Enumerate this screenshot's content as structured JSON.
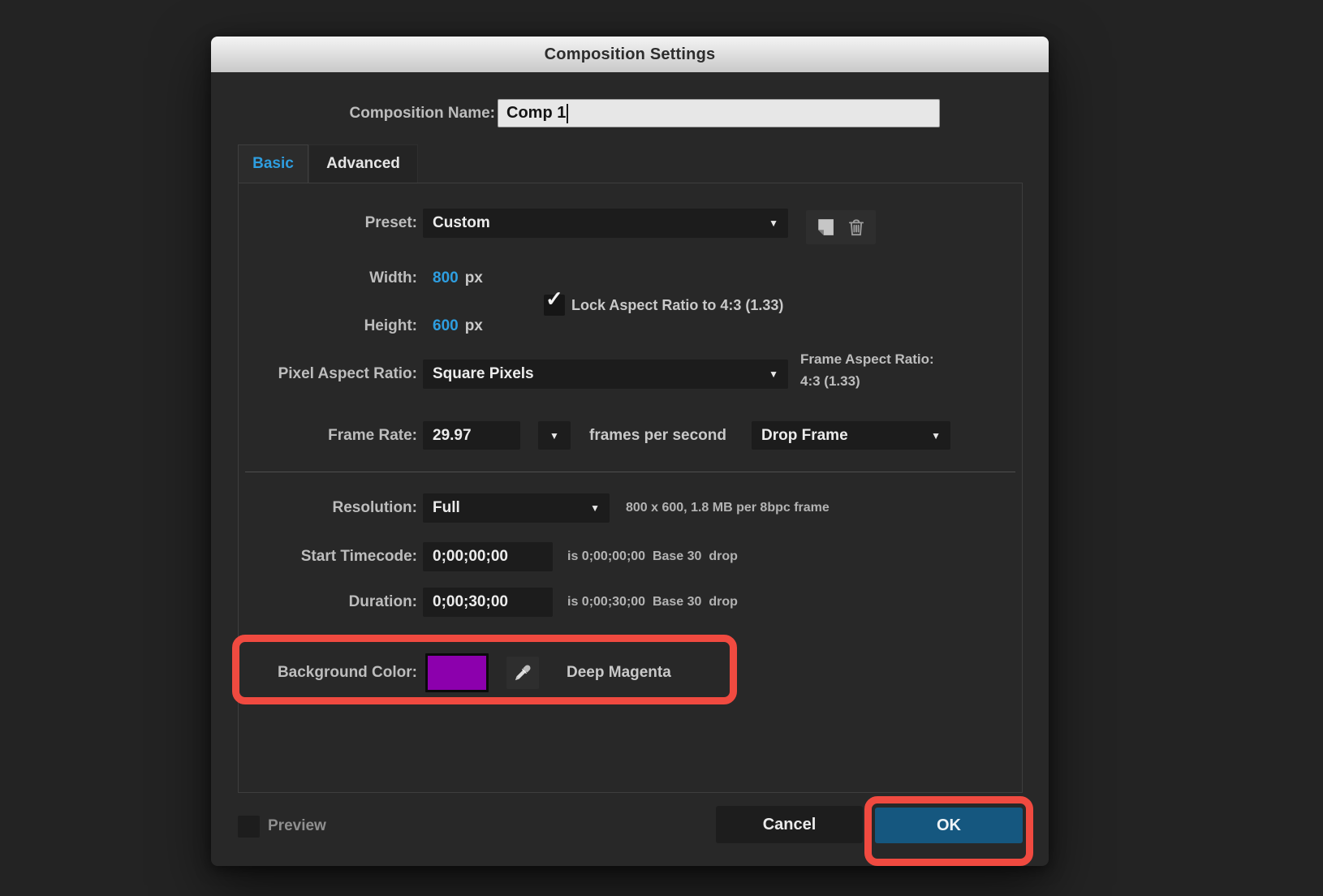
{
  "window": {
    "title": "Composition Settings"
  },
  "composition_name": {
    "label": "Composition Name:",
    "value": "Comp 1"
  },
  "tabs": [
    {
      "label": "Basic"
    },
    {
      "label": "Advanced"
    }
  ],
  "basic": {
    "preset": {
      "label": "Preset:",
      "value": "Custom"
    },
    "width": {
      "label": "Width:",
      "value": "800",
      "unit": "px"
    },
    "height": {
      "label": "Height:",
      "value": "600",
      "unit": "px"
    },
    "lock_aspect_ratio": {
      "label": "Lock Aspect Ratio to 4:3 (1.33)",
      "checked": true
    },
    "pixel_aspect_ratio": {
      "label": "Pixel Aspect Ratio:",
      "value": "Square Pixels"
    },
    "frame_aspect_ratio": {
      "label": "Frame Aspect Ratio:",
      "value": "4:3 (1.33)"
    },
    "frame_rate": {
      "label": "Frame Rate:",
      "value": "29.97",
      "unit": "frames per second",
      "timecode_style": "Drop Frame"
    },
    "resolution": {
      "label": "Resolution:",
      "value": "Full",
      "info": "800 x 600, 1.8 MB per 8bpc frame"
    },
    "start_timecode": {
      "label": "Start Timecode:",
      "value": "0;00;00;00",
      "info": "is 0;00;00;00  Base 30  drop"
    },
    "duration": {
      "label": "Duration:",
      "value": "0;00;30;00",
      "info": "is 0;00;30;00  Base 30  drop"
    },
    "background_color": {
      "label": "Background Color:",
      "color_name": "Deep Magenta",
      "swatch_hex": "#8C00AD"
    }
  },
  "footer": {
    "preview": {
      "label": "Preview",
      "checked": false
    },
    "cancel_label": "Cancel",
    "ok_label": "OK"
  },
  "icons": {
    "dropdown_arrow": "▼",
    "check": "✓"
  },
  "colors": {
    "accent_blue": "#2E9EE0",
    "ok_button_blue": "#15577F",
    "annotation_red": "#F04A40",
    "swatch_purple": "#8C00AD"
  }
}
